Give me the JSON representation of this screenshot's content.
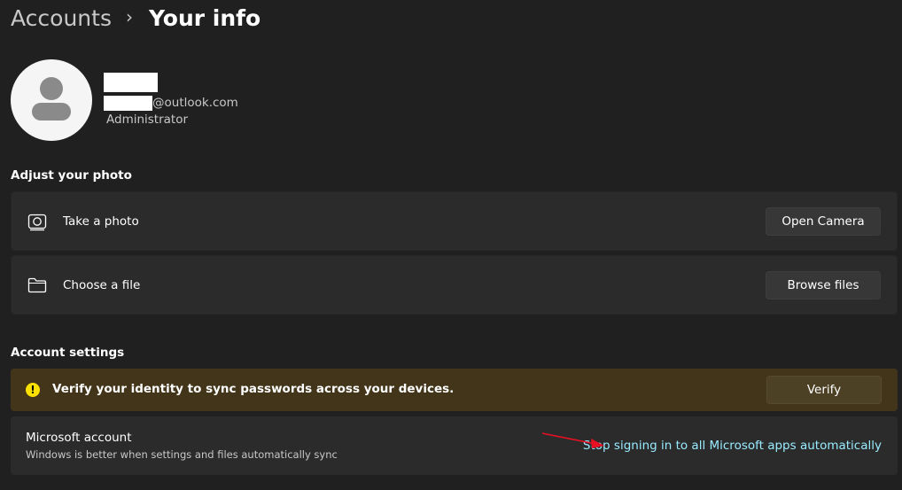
{
  "breadcrumb": {
    "parent": "Accounts",
    "separator": "›",
    "current": "Your info"
  },
  "profile": {
    "email_domain": "@outlook.com",
    "role": "Administrator"
  },
  "adjust_photo": {
    "title": "Adjust your photo",
    "take_photo": {
      "label": "Take a photo",
      "button": "Open Camera",
      "icon": "camera-icon"
    },
    "choose_file": {
      "label": "Choose a file",
      "button": "Browse files",
      "icon": "folder-icon"
    }
  },
  "account_settings": {
    "title": "Account settings",
    "warning": {
      "icon": "warning-icon",
      "glyph": "!",
      "text": "Verify your identity to sync passwords across your devices.",
      "button": "Verify"
    },
    "microsoft_account": {
      "title": "Microsoft account",
      "subtitle": "Windows is better when settings and files automatically sync",
      "link": "Stop signing in to all Microsoft apps automatically"
    }
  },
  "colors": {
    "accent_link": "#99ebff",
    "warning": "#fce100",
    "annotation_arrow": "#e81123"
  }
}
